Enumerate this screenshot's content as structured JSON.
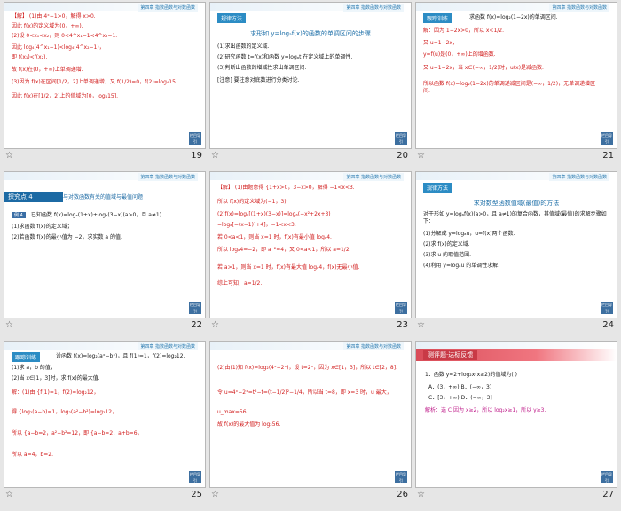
{
  "chapter_label": "第四章  指数函数与对数函数",
  "corner_label": "栏目导引",
  "slides": [
    {
      "number": "19",
      "lines": [
        "【解】 (1)由 4ˣ−1>0，解得 x>0.",
        "因此 f(x)的定义域为(0，+∞).",
        "(2)设 0<x₁<x₂，则 0<4^x₁−1<4^x₂−1.",
        "因此 log₄(4^x₁−1)<log₄(4^x₂−1)，",
        "即 f(x₁)<f(x₂).",
        "故 f(x)在(0，+∞)上单调递增.",
        "(3)因为 f(x)在区间[1/2，2]上单调递增，又 f(1/2)=0，f(2)=log₄15.",
        "因此 f(x)在[1/2，2]上的值域为[0，log₄15]."
      ]
    },
    {
      "number": "20",
      "tag": "规律方法",
      "heading": "求形如 y=logₐf(x)的函数的单调区间的步骤",
      "lines": [
        "(1)求出函数的定义域.",
        "(2)研究函数 t=f(x)和函数 y=logₐt 在定义域上的单调性.",
        "(3)判断出函数的增减性求出单调区间.",
        "[注意]  要注意对底数进行分类讨论."
      ]
    },
    {
      "number": "21",
      "tag": "跟踪训练",
      "lines": [
        "求函数 f(x)=log₂(1−2x)的单调区间.",
        "解：因为 1−2x>0，所以 x<1/2.",
        "又 u=1−2x，",
        "y=f(u)是(0，+∞)上的增函数.",
        "又 u=1−2x，当 x∈(−∞，1/2)时，u(x)是减函数.",
        "所以函数 f(x)=log₂(1−2x)的单调递减区间是(−∞，1/2)，无单调递增区间."
      ]
    },
    {
      "number": "22",
      "banner": "探究点 4",
      "banner_title": "与对数函数有关的值域与最值问题",
      "badge": "例 4",
      "lines": [
        "已知函数 f(x)=logₐ(1+x)+logₐ(3−x)(a>0，且 a≠1).",
        "(1)求函数 f(x)的定义域；",
        "(2)若函数 f(x)的最小值为 −2，求实数 a 的值."
      ]
    },
    {
      "number": "23",
      "lines": [
        "【解】 (1)由题意得 {1+x>0，3−x>0，解得 −1<x<3.",
        "所以 f(x)的定义域为(−1，3).",
        "(2)f(x)=logₐ[(1+x)(3−x)]=logₐ(−x²+2x+3)",
        "=logₐ[−(x−1)²+4]，−1<x<3.",
        "若 0<a<1，则当 x=1 时，f(x)有最小值 logₐ4.",
        "所以 logₐ4=−2，即 a⁻²=4，又 0<a<1，所以 a=1/2.",
        "若 a>1，则当 x=1 时，f(x)有最大值 logₐ4，f(x)无最小值.",
        "综上可知，a=1/2."
      ]
    },
    {
      "number": "24",
      "tag": "规律方法",
      "heading": "求对数型函数值域(最值)的方法",
      "lines": [
        "对于形如 y=logₐf(x)(a>0，且 a≠1)的复合函数，其值域(最值)的求解步骤如下：",
        "(1)分解成 y=logₐu，u=f(x)两个函数.",
        "(2)求 f(x)的定义域.",
        "(3)求 u 的取值范围.",
        "(4)利用 y=logₐu 的单调性求解."
      ]
    },
    {
      "number": "25",
      "tag": "跟踪训练",
      "lines": [
        "设函数 f(x)=log₂(aˣ−bˣ)，且 f(1)=1，f(2)=log₂12.",
        "(1)求 a，b 的值；",
        "(2)当 x∈[1，3]时，求 f(x)的最大值.",
        "解：(1)由 {f(1)=1，f(2)=log₂12，",
        "得 {log₂(a−b)=1，log₂(a²−b²)=log₂12，",
        "所以 {a−b=2，a²−b²=12，即 {a−b=2，a+b=6，",
        "所以 a=4，b=2."
      ]
    },
    {
      "number": "26",
      "lines": [
        "(2)由(1)知 f(x)=log₂(4ˣ−2ˣ)，设 t=2ˣ，因为 x∈[1，3]，所以 t∈[2，8].",
        "令 u=4ˣ−2ˣ=t²−t=(t−1/2)²−1/4，所以当 t=8，即 x=3 时，u 最大，",
        "u_max=56.",
        "故 f(x)的最大值为 log₂56."
      ]
    },
    {
      "number": "27",
      "ribbon": "测评题·达标反馈",
      "lines": [
        "1．函数 y=2+log₂x(x≥2)的值域为(    )",
        "A．(3，+∞)        B．(−∞，3)",
        "C．[3，+∞)        D．(−∞，3]",
        "解析：选 C  因为 x≥2，所以 log₂x≥1，所以 y≥3."
      ]
    }
  ]
}
